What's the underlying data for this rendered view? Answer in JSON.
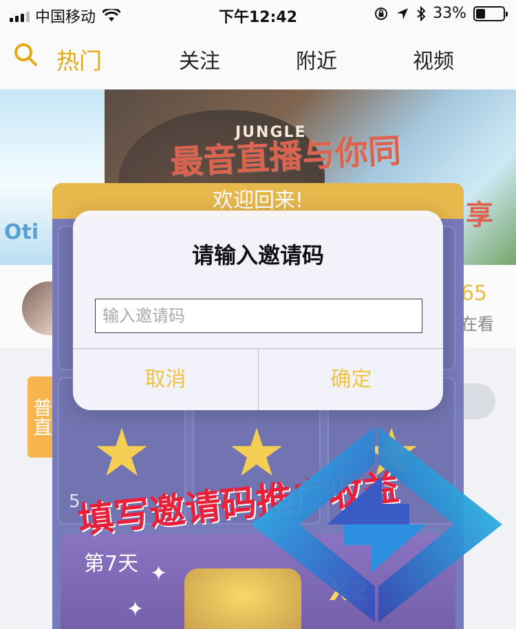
{
  "status_bar": {
    "carrier": "中国移动",
    "time": "下午12:42",
    "battery_percent": "33%",
    "battery_level": 0.33,
    "icons": [
      "signal-icon",
      "wifi-icon",
      "orientation-lock-icon",
      "location-icon",
      "bluetooth-icon",
      "battery-icon"
    ]
  },
  "nav": {
    "tabs": [
      {
        "label": "热门",
        "active": true
      },
      {
        "label": "关注",
        "active": false
      },
      {
        "label": "附近",
        "active": false
      },
      {
        "label": "视频",
        "active": false
      }
    ],
    "search_icon": "search-icon"
  },
  "banner": {
    "left_brand": "Oti",
    "guitar_logo": "JUNGLE",
    "headline": "最音直播与你同",
    "slogan": "享"
  },
  "live_card": {
    "viewer_count": "65",
    "viewer_label": "在看"
  },
  "side_tag": "普直",
  "checkin": {
    "header": "欢迎回来!",
    "day_label_5": "5",
    "day7_label": "第7天",
    "multiplier": "X2"
  },
  "dialog": {
    "title": "请输入邀请码",
    "input_placeholder": "输入邀请码",
    "input_value": "",
    "cancel_label": "取消",
    "confirm_label": "确定"
  },
  "promo_caption": "填写邀请码推广收益",
  "colors": {
    "accent": "#e3a912",
    "dialog_button": "#f1c342",
    "checkin_bg": "#5256a6",
    "caption": "#e8203a"
  }
}
